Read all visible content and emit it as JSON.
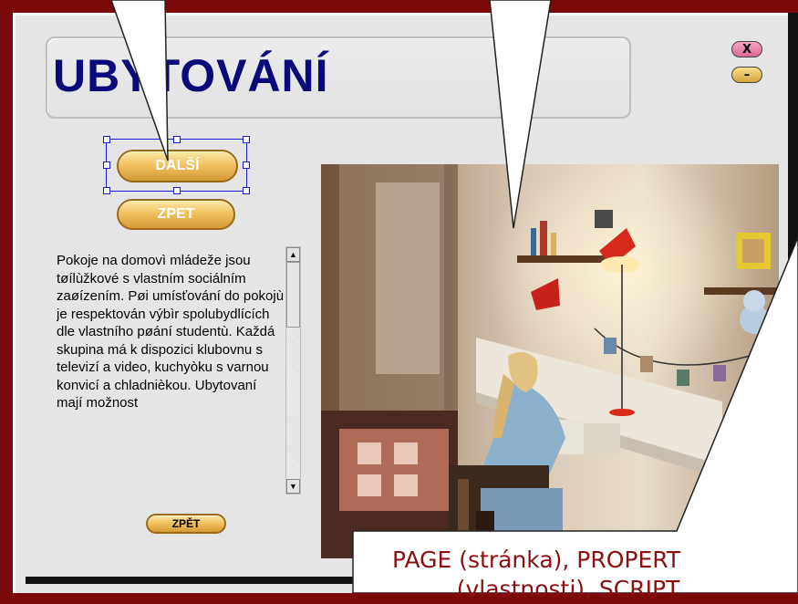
{
  "page": {
    "title": "UBYTOVÁNÍ",
    "window_controls": {
      "close_label": "X",
      "minimize_label": "–"
    }
  },
  "nav": {
    "next_label": "DALŠÍ",
    "back_label": "ZPET",
    "back_small_label": "ZPĚT"
  },
  "article": {
    "text": "Pokoje na domovì mládeže jsou tøílùžkové s vlastním sociálním zaøízením. Pøi umísťování do pokojù je respektován výbìr spolubydlících dle vlastního pøání studentù. Každá skupina má k dispozici klubovnu s televizí a video, kuchyòku s varnou konvicí a chladnièkou. Ubytovaní mají možnost"
  },
  "photo": {
    "icon": "dorm-room-photo"
  },
  "callout": {
    "line1": "PAGE (stránka), PROPERT",
    "line2": "(vlastnosti), SCRIPT"
  },
  "colors": {
    "frame": "#7a0a0a",
    "title": "#0a0a7a",
    "callout_text": "#8a0f0f",
    "button_gold": "#f2c262"
  }
}
